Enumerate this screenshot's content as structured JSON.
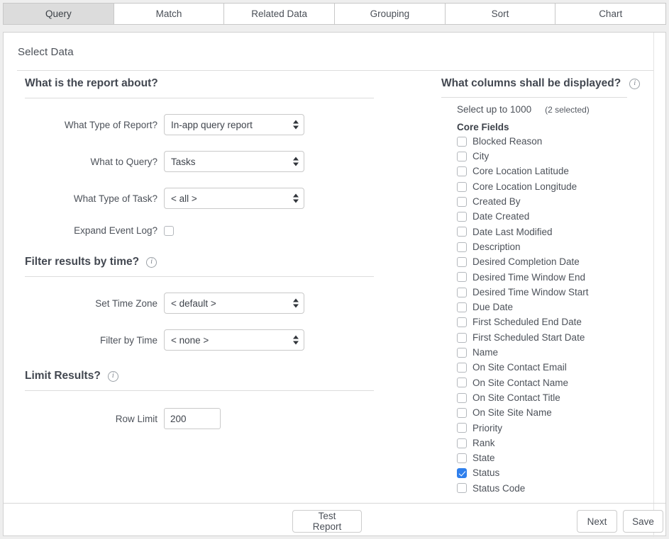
{
  "tabs": [
    {
      "label": "Query",
      "active": true
    },
    {
      "label": "Match",
      "active": false
    },
    {
      "label": "Related Data",
      "active": false
    },
    {
      "label": "Grouping",
      "active": false
    },
    {
      "label": "Sort",
      "active": false
    },
    {
      "label": "Chart",
      "active": false
    }
  ],
  "card": {
    "title": "Select Data"
  },
  "left": {
    "section1": {
      "heading": "What is the report about?",
      "fields": [
        {
          "label": "What Type of Report?",
          "value": "In-app query report",
          "control": "select"
        },
        {
          "label": "What to Query?",
          "value": "Tasks",
          "control": "select"
        },
        {
          "label": "What Type of Task?",
          "value": "< all >",
          "control": "select"
        }
      ],
      "checkbox": {
        "label": "Expand Event Log?",
        "checked": false
      }
    },
    "section2": {
      "heading": "Filter results by time?",
      "info_icon": "info-icon",
      "fields": [
        {
          "label": "Set Time Zone",
          "value": "< default >",
          "control": "select"
        },
        {
          "label": "Filter by Time",
          "value": "< none >",
          "control": "select"
        }
      ]
    },
    "section3": {
      "heading": "Limit Results?",
      "info_icon": "info-icon",
      "field": {
        "label": "Row Limit",
        "value": "200",
        "control": "text"
      }
    }
  },
  "right": {
    "heading": "What columns shall be displayed?",
    "info_icon": "info-icon",
    "select_limit": "Select up to 1000",
    "selected_count": "(2 selected)",
    "group_heading": "Core Fields",
    "columns": [
      {
        "label": "Blocked Reason",
        "checked": false
      },
      {
        "label": "City",
        "checked": false
      },
      {
        "label": "Core Location Latitude",
        "checked": false
      },
      {
        "label": "Core Location Longitude",
        "checked": false
      },
      {
        "label": "Created By",
        "checked": false
      },
      {
        "label": "Date Created",
        "checked": false
      },
      {
        "label": "Date Last Modified",
        "checked": false
      },
      {
        "label": "Description",
        "checked": false
      },
      {
        "label": "Desired Completion Date",
        "checked": false
      },
      {
        "label": "Desired Time Window End",
        "checked": false
      },
      {
        "label": "Desired Time Window Start",
        "checked": false
      },
      {
        "label": "Due Date",
        "checked": false
      },
      {
        "label": "First Scheduled End Date",
        "checked": false
      },
      {
        "label": "First Scheduled Start Date",
        "checked": false
      },
      {
        "label": "Name",
        "checked": false
      },
      {
        "label": "On Site Contact Email",
        "checked": false
      },
      {
        "label": "On Site Contact Name",
        "checked": false
      },
      {
        "label": "On Site Contact Title",
        "checked": false
      },
      {
        "label": "On Site Site Name",
        "checked": false
      },
      {
        "label": "Priority",
        "checked": false
      },
      {
        "label": "Rank",
        "checked": false
      },
      {
        "label": "State",
        "checked": false
      },
      {
        "label": "Status",
        "checked": true
      },
      {
        "label": "Status Code",
        "checked": false
      }
    ]
  },
  "footer": {
    "test_report": "Test Report",
    "next": "Next",
    "save": "Save"
  },
  "colors": {
    "accent": "#2f7fec",
    "active_tab_bg": "#dcdcdc",
    "page_bg": "#eeeeee",
    "card_bg": "#ffffff",
    "text": "#4d525a"
  }
}
